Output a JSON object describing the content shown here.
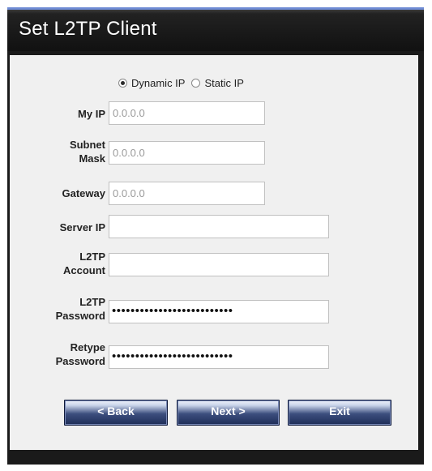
{
  "window": {
    "title": "Set L2TP Client"
  },
  "ip_mode": {
    "dynamic_label": "Dynamic IP",
    "static_label": "Static IP",
    "selected": "Dynamic IP"
  },
  "fields": {
    "my_ip": {
      "label": "My IP",
      "value": "0.0.0.0"
    },
    "subnet_mask": {
      "label_line1": "Subnet",
      "label_line2": "Mask",
      "value": "0.0.0.0"
    },
    "gateway": {
      "label": "Gateway",
      "value": "0.0.0.0"
    },
    "server_ip": {
      "label": "Server IP",
      "value": ""
    },
    "l2tp_account": {
      "label_line1": "L2TP",
      "label_line2": "Account",
      "value": ""
    },
    "l2tp_password": {
      "label_line1": "L2TP",
      "label_line2": "Password",
      "masked": "••••••••••••••••••••••••••"
    },
    "retype_password": {
      "label_line1": "Retype",
      "label_line2": "Password",
      "masked": "••••••••••••••••••••••••••"
    }
  },
  "buttons": {
    "back": "< Back",
    "next": "Next >",
    "exit": "Exit"
  }
}
